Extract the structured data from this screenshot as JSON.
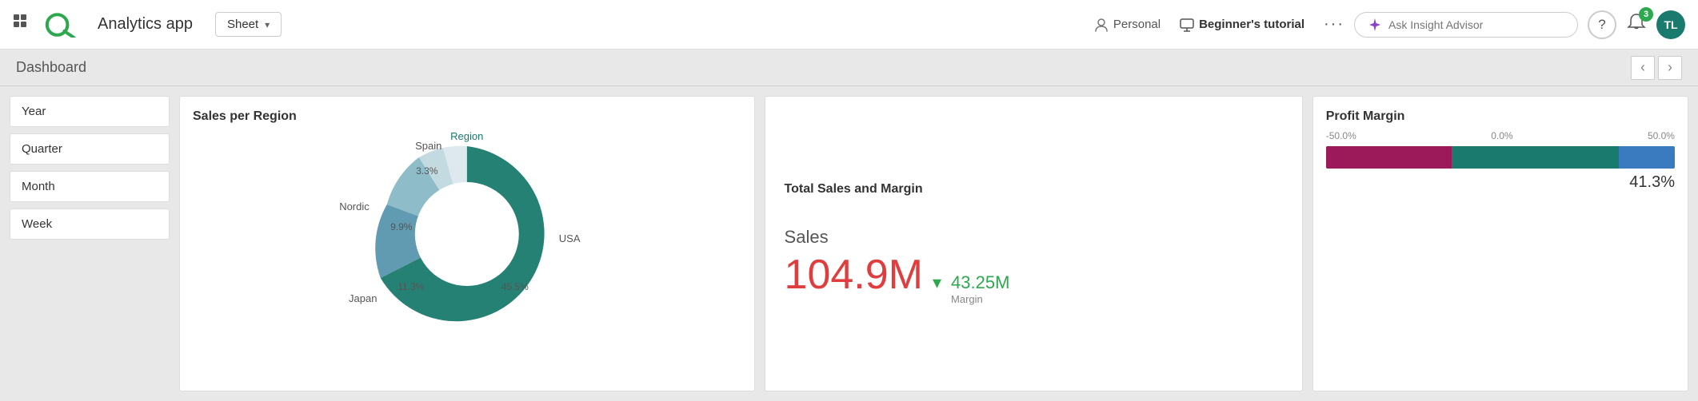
{
  "topnav": {
    "app_title": "Analytics app",
    "sheet_label": "Sheet",
    "personal_label": "Personal",
    "tutorial_label": "Beginner's tutorial",
    "dots_label": "···",
    "insight_placeholder": "Ask Insight Advisor",
    "help_label": "?",
    "notif_badge": "3",
    "avatar_initials": "TL"
  },
  "subheader": {
    "title": "Dashboard",
    "prev_label": "‹",
    "next_label": "›"
  },
  "sidebar": {
    "filters": [
      {
        "label": "Year"
      },
      {
        "label": "Quarter"
      },
      {
        "label": "Month"
      },
      {
        "label": "Week"
      }
    ]
  },
  "charts": {
    "sales_region": {
      "title": "Sales per Region",
      "legend_label": "Region",
      "segments": [
        {
          "label": "USA",
          "pct": "45.5%",
          "color": "#1a7a6e"
        },
        {
          "label": "Spain",
          "pct": "3.3%",
          "color": "#b0c8d4"
        },
        {
          "label": "Nordic",
          "pct": "9.9%",
          "color": "#7ab0c0"
        },
        {
          "label": "Japan",
          "pct": "11.3%",
          "color": "#5090a8"
        }
      ]
    },
    "total_sales": {
      "title": "Total Sales and Margin",
      "sales_label": "Sales",
      "sales_value": "104.9M",
      "margin_value": "43.25M",
      "margin_label": "Margin"
    },
    "profit_margin": {
      "title": "Profit Margin",
      "axis_left": "-50.0%",
      "axis_center": "0.0%",
      "axis_right": "50.0%",
      "value": "41.3%"
    }
  },
  "icons": {
    "grid": "⊞",
    "chevron_down": "▾",
    "personal": "👤",
    "monitor": "🖥",
    "sparkle": "✦",
    "bell": "🔔",
    "question": "?"
  }
}
